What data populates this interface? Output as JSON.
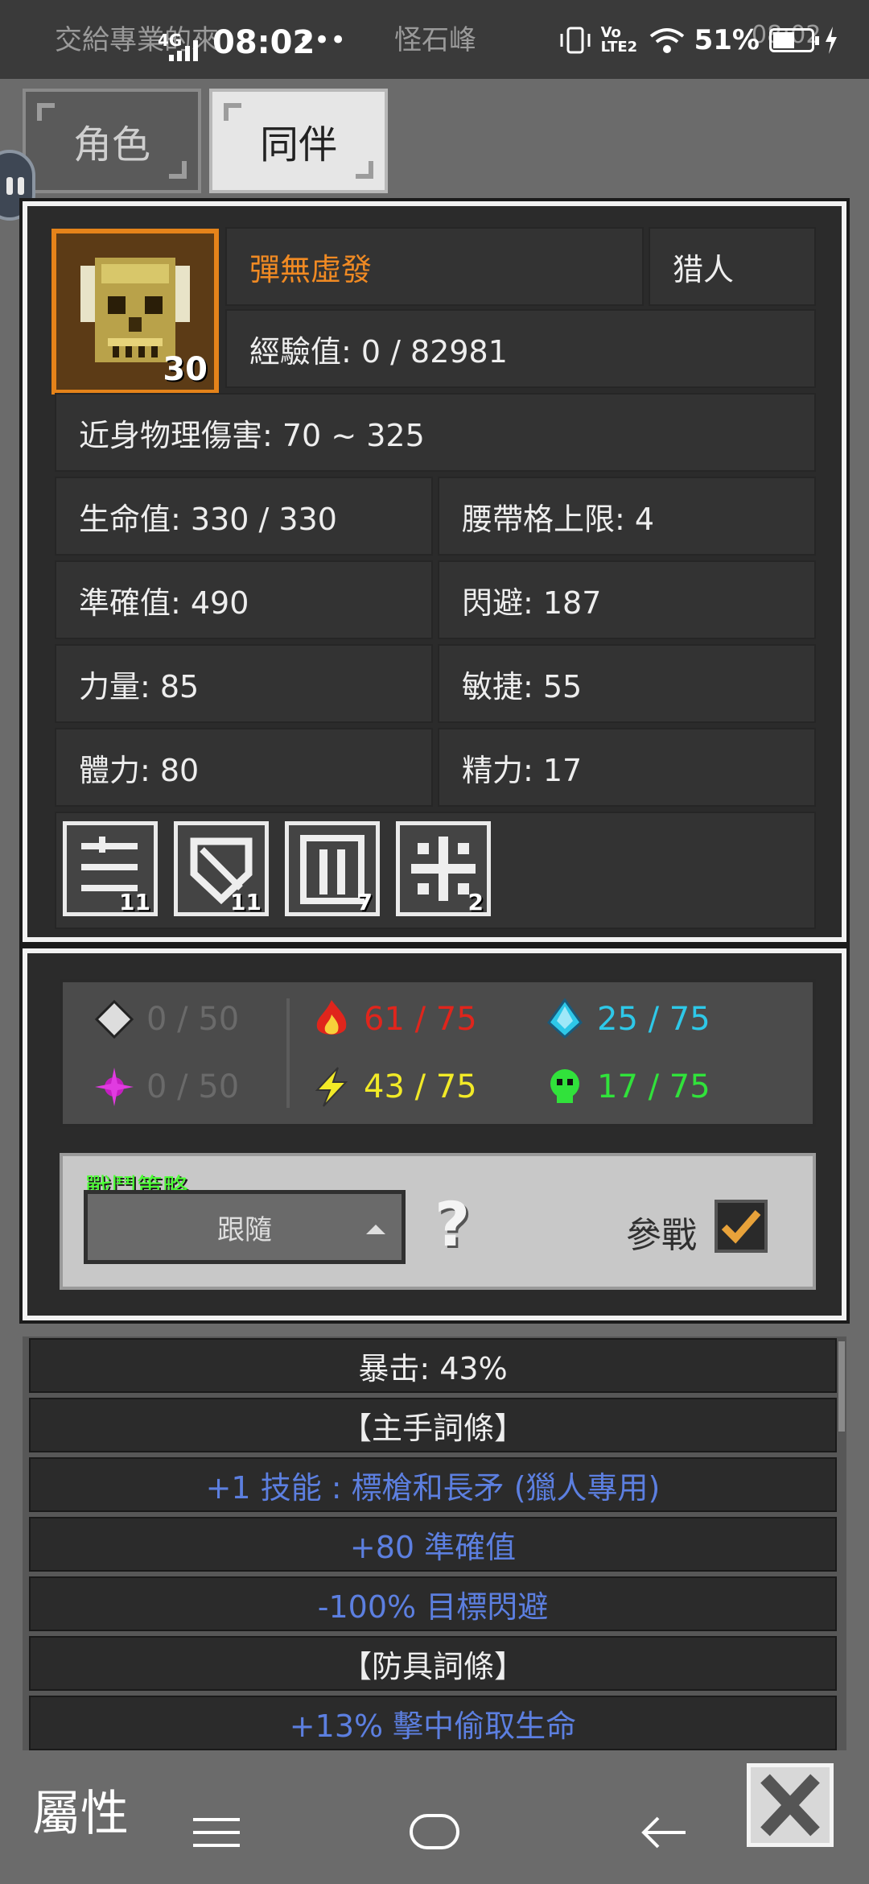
{
  "status_bar": {
    "ghost_left": "交給專業的來",
    "ghost_center": "怪石峰",
    "ghost_right": "08:02",
    "network": "4G",
    "time": "08:02",
    "dots": "•••",
    "lte": "Vo LTE2",
    "battery": "51%"
  },
  "tabs": [
    {
      "label": "角色",
      "active": false
    },
    {
      "label": "同伴",
      "active": true
    }
  ],
  "character": {
    "name": "彈無虛發",
    "class": "猎人",
    "level": "30",
    "exp": "經驗值: 0 / 82981",
    "melee_damage": "近身物理傷害: 70 ~ 325"
  },
  "stats": [
    {
      "left": "生命值: 330 / 330",
      "right": "腰帶格上限: 4"
    },
    {
      "left": "準確值: 490",
      "right": "閃避: 187"
    },
    {
      "left": "力量: 85",
      "right": "敏捷: 55"
    },
    {
      "left": "體力: 80",
      "right": "精力: 17"
    }
  ],
  "skills": [
    {
      "icon": "skill-lines-icon",
      "count": "11"
    },
    {
      "icon": "skill-shield-icon",
      "count": "11"
    },
    {
      "icon": "skill-gate-icon",
      "count": "7"
    },
    {
      "icon": "skill-cross-icon",
      "count": "2"
    }
  ],
  "resistances": {
    "physical": "0 / 50",
    "magic": "0 / 50",
    "fire": "61 / 75",
    "lightning": "43 / 75",
    "cold": "25 / 75",
    "poison": "17 / 75",
    "colors": {
      "fire": "#e0251c",
      "lightning": "#f2ea27",
      "cold": "#2ec8e8",
      "poison": "#31e23b",
      "dim": "#6a6a6a"
    }
  },
  "strategy": {
    "label": "戰鬥策略",
    "selected": "跟隨",
    "help": "?",
    "join_label": "參戰"
  },
  "affix_list": [
    {
      "text": "暴击: 43%",
      "style": "white"
    },
    {
      "text": "【主手詞條】",
      "style": "white"
    },
    {
      "text": "+1 技能 : 標槍和長矛 (獵人專用)",
      "style": "blue"
    },
    {
      "text": "+80 準確值",
      "style": "blue"
    },
    {
      "text": "-100% 目標閃避",
      "style": "blue"
    },
    {
      "text": "【防具詞條】",
      "style": "white"
    },
    {
      "text": "+13% 擊中偷取生命",
      "style": "blue"
    }
  ],
  "bottom": {
    "label": "屬性"
  }
}
